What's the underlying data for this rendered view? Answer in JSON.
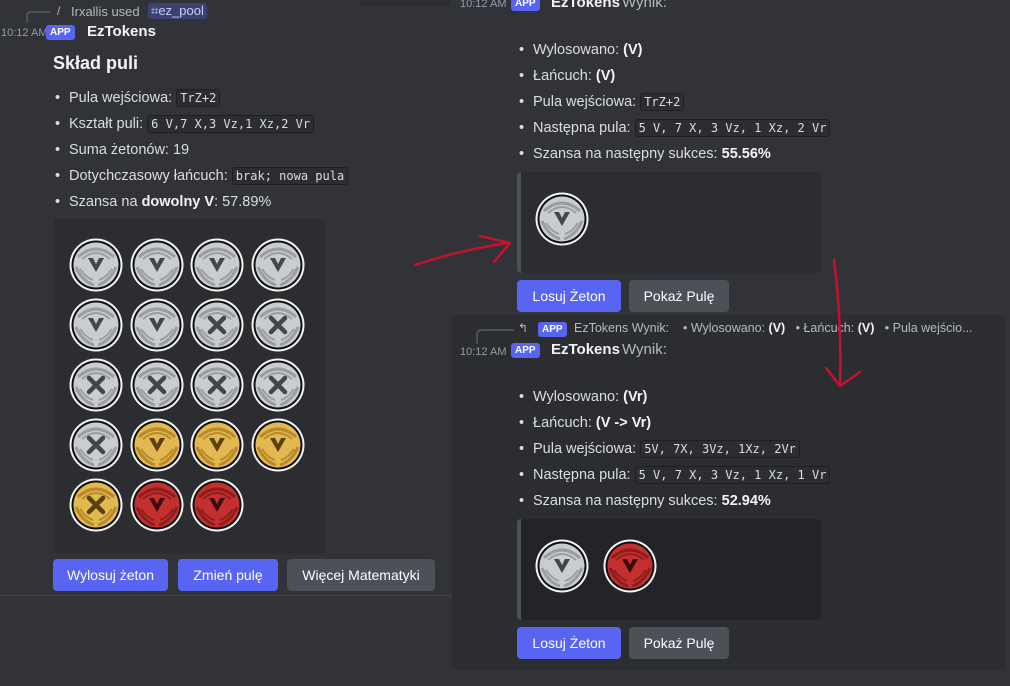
{
  "left": {
    "used_user": "Irxallis used",
    "command": "ez_pool",
    "timestamp": "10:12 AM",
    "app_badge": "APP",
    "author": "EzTokens",
    "title": "Skład puli",
    "items": [
      {
        "label": "Pula wejściowa: ",
        "code": "TrZ+2"
      },
      {
        "label": "Kształt puli: ",
        "code": "6 V,7 X,3 Vz,1 Xz,2 Vr"
      },
      {
        "label": "Suma żetonów: 19"
      },
      {
        "label": "Dotychczasowy łańcuch: ",
        "code": "brak; nowa pula"
      },
      {
        "label": "Szansa na ",
        "bold": "dowolny V",
        "tail": ": 57.89%"
      }
    ],
    "tokens": [
      "silver-v",
      "silver-v",
      "silver-v",
      "silver-v",
      "silver-v",
      "silver-v",
      "silver-x",
      "silver-x",
      "silver-x",
      "silver-x",
      "silver-x",
      "silver-x",
      "silver-x",
      "gold-v",
      "gold-v",
      "gold-v",
      "gold-x",
      "red-v",
      "red-v"
    ],
    "buttons": [
      "Wylosuj żeton",
      "Zmień pulę",
      "Więcej Matematyki"
    ]
  },
  "right1": {
    "timestamp": "10:12 AM",
    "app_badge": "APP",
    "author": "EzTokens",
    "wynik": "Wynik:",
    "items": [
      {
        "label": "Wylosowano: ",
        "bold": "(V)"
      },
      {
        "label": "Łańcuch: ",
        "bold": "(V)"
      },
      {
        "label": "Pula wejściowa: ",
        "code": "TrZ+2"
      },
      {
        "label": "Następna pula: ",
        "code": "5 V, 7 X, 3 Vz, 1 Xz, 2 Vr"
      },
      {
        "label": "Szansa na następny sukces: ",
        "bold": "55.56%"
      }
    ],
    "tokens": [
      "silver-v"
    ],
    "buttons": [
      "Losuj Żeton",
      "Pokaż Pulę"
    ]
  },
  "right2": {
    "reply_badge": "APP",
    "reply_author": "EzTokens",
    "reply_wynik": "Wynik:",
    "reply_p1": "• Wylosowano: ",
    "reply_b1": "(V)",
    "reply_p2": "• Łańcuch: ",
    "reply_b2": "(V)",
    "reply_p3": "• Pula wejścio...",
    "timestamp": "10:12 AM",
    "app_badge": "APP",
    "author": "EzTokens",
    "wynik": "Wynik:",
    "items": [
      {
        "label": "Wylosowano: ",
        "bold": "(Vr)"
      },
      {
        "label": "Łańcuch: ",
        "bold": "(V -> Vr)"
      },
      {
        "label": "Pula wejściowa: ",
        "code": "5V, 7X, 3Vz, 1Xz, 2Vr"
      },
      {
        "label": "Następna pula: ",
        "code": "5 V, 7 X, 3 Vz, 1 Xz, 1 Vr"
      },
      {
        "label": "Szansa na następny sukces: ",
        "bold": "52.94%"
      }
    ],
    "tokens": [
      "silver-v",
      "red-v"
    ],
    "buttons": [
      "Losuj Żeton",
      "Pokaż Pulę"
    ]
  },
  "top_timestamp": "10:12 AM",
  "top_author": "EzTokens",
  "top_wynik": "Wynik:",
  "colors": {
    "accent": "#5865f2",
    "annotation_arrow": "#c8102e"
  }
}
